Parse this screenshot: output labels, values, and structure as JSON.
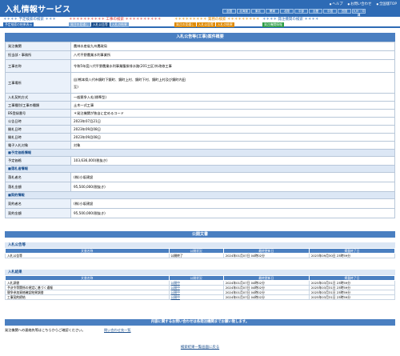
{
  "header": {
    "logo": "入札情報サービス",
    "links": [
      "ヘルプ",
      "お問い合わせ",
      "全国版TOP"
    ],
    "regions": [
      "全国",
      "北海道",
      "東北",
      "関東",
      "北陸",
      "中部",
      "近畿",
      "中国",
      "四国",
      "九州・沖縄"
    ]
  },
  "nav": {
    "groups": [
      {
        "title": "＊＊＊＊ 予定検索の検索 ＊＊＊",
        "color": "blue",
        "tabs": [
          "予定検索の結果表示"
        ]
      },
      {
        "title": "＊＊＊＊＊＊＊＊＊＊ 工事の検索 ＊＊＊＊＊＊＊＊＊＊",
        "color": "red",
        "tabs": [
          "発注の見通し",
          "入札公告等",
          "入札の結果"
        ]
      },
      {
        "title": "＊＊＊＊＊＊＊＊＊ 業務の検索 ＊＊＊＊＊＊＊＊＊",
        "color": "orange",
        "tabs": [
          "発注の見通し",
          "入札公告等",
          "入札の結果"
        ]
      },
      {
        "title": "＊＊＊＊ 発注機関の検索 ＊＊＊＊",
        "color": "green",
        "tabs": [
          "発注機関情報"
        ]
      }
    ]
  },
  "detail": {
    "title": "入札公告等(工事)案件概要",
    "rows": [
      {
        "label": "発注機関",
        "value": "農林水産省九州農政局"
      },
      {
        "label": "担当部・事務所",
        "value": "八代平野農業水利事業所"
      },
      {
        "label": "工事名称",
        "value": "令和5年度八代平野農業水利事業腹掛排水路(201工区)外改修工事"
      },
      {
        "label": "工事場所",
        "value": "自)熊本県八代市鏡町下鏡町、鏡町上村、鏡町下村、鏡町上村及び鏡町内田 \n至)"
      },
      {
        "label": "入札契約方式",
        "value": "一般競争入札(標準型)"
      },
      {
        "label": "工事種別/工事の種類",
        "value": "土木一式工事"
      },
      {
        "label": "BS登録番号",
        "value": "＊発注機関が独自に定めるコード"
      },
      {
        "label": "公告日時",
        "value": "2023年07月21日"
      },
      {
        "label": "開札日時",
        "value": "2023年09月08日"
      },
      {
        "label": "開札日時",
        "value": "2023年09月08日"
      },
      {
        "label": "電子入札対象",
        "value": "対象"
      }
    ],
    "sections": [
      {
        "title": "■予定価格情報",
        "rows": [
          {
            "label": "予定価格",
            "value": "103,636,000(税抜き)"
          }
        ]
      },
      {
        "title": "■落札者情報",
        "rows": [
          {
            "label": "落札者名",
            "value": "(株)小坂建設"
          },
          {
            "label": "落札金額",
            "value": "95,500,000(税抜き)"
          }
        ]
      },
      {
        "title": "■契約情報",
        "rows": [
          {
            "label": "契約者名",
            "value": "(株)小坂建設"
          },
          {
            "label": "契約金額",
            "value": "95,500,000(税抜き)"
          }
        ]
      }
    ]
  },
  "docs": {
    "title": "公開文書",
    "groups": [
      {
        "title": "入札公告等",
        "headers": [
          "文書名称",
          "公開状況",
          "最終更新日",
          "掲載終了日"
        ],
        "rows": [
          [
            "入札公告等",
            "公開終了",
            "2024年01月07日 04時02分",
            "2023年09月30日 23時59分"
          ]
        ]
      },
      {
        "title": "入札結果",
        "headers": [
          "文書名称",
          "公開状況",
          "最終更新日",
          "掲載終了日"
        ],
        "rows": [
          [
            "入札調書",
            "公開中",
            "2024年01月07日 04時02分",
            "2025年03月31日 23時59分"
          ],
          [
            "予決令等関係の規定に基づく通報",
            "公開中",
            "2024年01月07日 04時02分",
            "2025年03月31日 23時59分"
          ],
          [
            "競争参加資格確認結果調書",
            "公開中",
            "2024年01月07日 04時02分",
            "2025年03月31日 23時59分"
          ],
          [
            "工事契約締結",
            "公開中",
            "2024年01月07日 04時02分",
            "2025年03月31日 23時59分"
          ]
        ]
      }
    ]
  },
  "inquiry": {
    "bar": "内容に関するお問い合わせは各発注機関までお願い致します。",
    "text": "発注機関への連絡先等はこちらからご確認ください。",
    "link": "問い合わせ先一覧"
  },
  "back": "検索結果一覧画面に戻る"
}
